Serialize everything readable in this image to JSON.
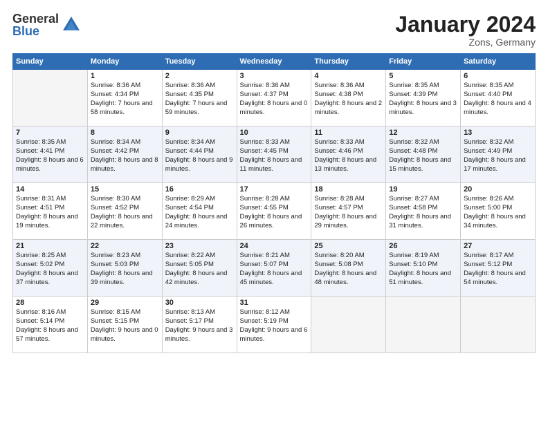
{
  "header": {
    "logo_general": "General",
    "logo_blue": "Blue",
    "title": "January 2024",
    "subtitle": "Zons, Germany"
  },
  "days_of_week": [
    "Sunday",
    "Monday",
    "Tuesday",
    "Wednesday",
    "Thursday",
    "Friday",
    "Saturday"
  ],
  "weeks": [
    [
      {
        "day": "",
        "sunrise": "",
        "sunset": "",
        "daylight": ""
      },
      {
        "day": "1",
        "sunrise": "Sunrise: 8:36 AM",
        "sunset": "Sunset: 4:34 PM",
        "daylight": "Daylight: 7 hours and 58 minutes."
      },
      {
        "day": "2",
        "sunrise": "Sunrise: 8:36 AM",
        "sunset": "Sunset: 4:35 PM",
        "daylight": "Daylight: 7 hours and 59 minutes."
      },
      {
        "day": "3",
        "sunrise": "Sunrise: 8:36 AM",
        "sunset": "Sunset: 4:37 PM",
        "daylight": "Daylight: 8 hours and 0 minutes."
      },
      {
        "day": "4",
        "sunrise": "Sunrise: 8:36 AM",
        "sunset": "Sunset: 4:38 PM",
        "daylight": "Daylight: 8 hours and 2 minutes."
      },
      {
        "day": "5",
        "sunrise": "Sunrise: 8:35 AM",
        "sunset": "Sunset: 4:39 PM",
        "daylight": "Daylight: 8 hours and 3 minutes."
      },
      {
        "day": "6",
        "sunrise": "Sunrise: 8:35 AM",
        "sunset": "Sunset: 4:40 PM",
        "daylight": "Daylight: 8 hours and 4 minutes."
      }
    ],
    [
      {
        "day": "7",
        "sunrise": "Sunrise: 8:35 AM",
        "sunset": "Sunset: 4:41 PM",
        "daylight": "Daylight: 8 hours and 6 minutes."
      },
      {
        "day": "8",
        "sunrise": "Sunrise: 8:34 AM",
        "sunset": "Sunset: 4:42 PM",
        "daylight": "Daylight: 8 hours and 8 minutes."
      },
      {
        "day": "9",
        "sunrise": "Sunrise: 8:34 AM",
        "sunset": "Sunset: 4:44 PM",
        "daylight": "Daylight: 8 hours and 9 minutes."
      },
      {
        "day": "10",
        "sunrise": "Sunrise: 8:33 AM",
        "sunset": "Sunset: 4:45 PM",
        "daylight": "Daylight: 8 hours and 11 minutes."
      },
      {
        "day": "11",
        "sunrise": "Sunrise: 8:33 AM",
        "sunset": "Sunset: 4:46 PM",
        "daylight": "Daylight: 8 hours and 13 minutes."
      },
      {
        "day": "12",
        "sunrise": "Sunrise: 8:32 AM",
        "sunset": "Sunset: 4:48 PM",
        "daylight": "Daylight: 8 hours and 15 minutes."
      },
      {
        "day": "13",
        "sunrise": "Sunrise: 8:32 AM",
        "sunset": "Sunset: 4:49 PM",
        "daylight": "Daylight: 8 hours and 17 minutes."
      }
    ],
    [
      {
        "day": "14",
        "sunrise": "Sunrise: 8:31 AM",
        "sunset": "Sunset: 4:51 PM",
        "daylight": "Daylight: 8 hours and 19 minutes."
      },
      {
        "day": "15",
        "sunrise": "Sunrise: 8:30 AM",
        "sunset": "Sunset: 4:52 PM",
        "daylight": "Daylight: 8 hours and 22 minutes."
      },
      {
        "day": "16",
        "sunrise": "Sunrise: 8:29 AM",
        "sunset": "Sunset: 4:54 PM",
        "daylight": "Daylight: 8 hours and 24 minutes."
      },
      {
        "day": "17",
        "sunrise": "Sunrise: 8:28 AM",
        "sunset": "Sunset: 4:55 PM",
        "daylight": "Daylight: 8 hours and 26 minutes."
      },
      {
        "day": "18",
        "sunrise": "Sunrise: 8:28 AM",
        "sunset": "Sunset: 4:57 PM",
        "daylight": "Daylight: 8 hours and 29 minutes."
      },
      {
        "day": "19",
        "sunrise": "Sunrise: 8:27 AM",
        "sunset": "Sunset: 4:58 PM",
        "daylight": "Daylight: 8 hours and 31 minutes."
      },
      {
        "day": "20",
        "sunrise": "Sunrise: 8:26 AM",
        "sunset": "Sunset: 5:00 PM",
        "daylight": "Daylight: 8 hours and 34 minutes."
      }
    ],
    [
      {
        "day": "21",
        "sunrise": "Sunrise: 8:25 AM",
        "sunset": "Sunset: 5:02 PM",
        "daylight": "Daylight: 8 hours and 37 minutes."
      },
      {
        "day": "22",
        "sunrise": "Sunrise: 8:23 AM",
        "sunset": "Sunset: 5:03 PM",
        "daylight": "Daylight: 8 hours and 39 minutes."
      },
      {
        "day": "23",
        "sunrise": "Sunrise: 8:22 AM",
        "sunset": "Sunset: 5:05 PM",
        "daylight": "Daylight: 8 hours and 42 minutes."
      },
      {
        "day": "24",
        "sunrise": "Sunrise: 8:21 AM",
        "sunset": "Sunset: 5:07 PM",
        "daylight": "Daylight: 8 hours and 45 minutes."
      },
      {
        "day": "25",
        "sunrise": "Sunrise: 8:20 AM",
        "sunset": "Sunset: 5:08 PM",
        "daylight": "Daylight: 8 hours and 48 minutes."
      },
      {
        "day": "26",
        "sunrise": "Sunrise: 8:19 AM",
        "sunset": "Sunset: 5:10 PM",
        "daylight": "Daylight: 8 hours and 51 minutes."
      },
      {
        "day": "27",
        "sunrise": "Sunrise: 8:17 AM",
        "sunset": "Sunset: 5:12 PM",
        "daylight": "Daylight: 8 hours and 54 minutes."
      }
    ],
    [
      {
        "day": "28",
        "sunrise": "Sunrise: 8:16 AM",
        "sunset": "Sunset: 5:14 PM",
        "daylight": "Daylight: 8 hours and 57 minutes."
      },
      {
        "day": "29",
        "sunrise": "Sunrise: 8:15 AM",
        "sunset": "Sunset: 5:15 PM",
        "daylight": "Daylight: 9 hours and 0 minutes."
      },
      {
        "day": "30",
        "sunrise": "Sunrise: 8:13 AM",
        "sunset": "Sunset: 5:17 PM",
        "daylight": "Daylight: 9 hours and 3 minutes."
      },
      {
        "day": "31",
        "sunrise": "Sunrise: 8:12 AM",
        "sunset": "Sunset: 5:19 PM",
        "daylight": "Daylight: 9 hours and 6 minutes."
      },
      {
        "day": "",
        "sunrise": "",
        "sunset": "",
        "daylight": ""
      },
      {
        "day": "",
        "sunrise": "",
        "sunset": "",
        "daylight": ""
      },
      {
        "day": "",
        "sunrise": "",
        "sunset": "",
        "daylight": ""
      }
    ]
  ]
}
